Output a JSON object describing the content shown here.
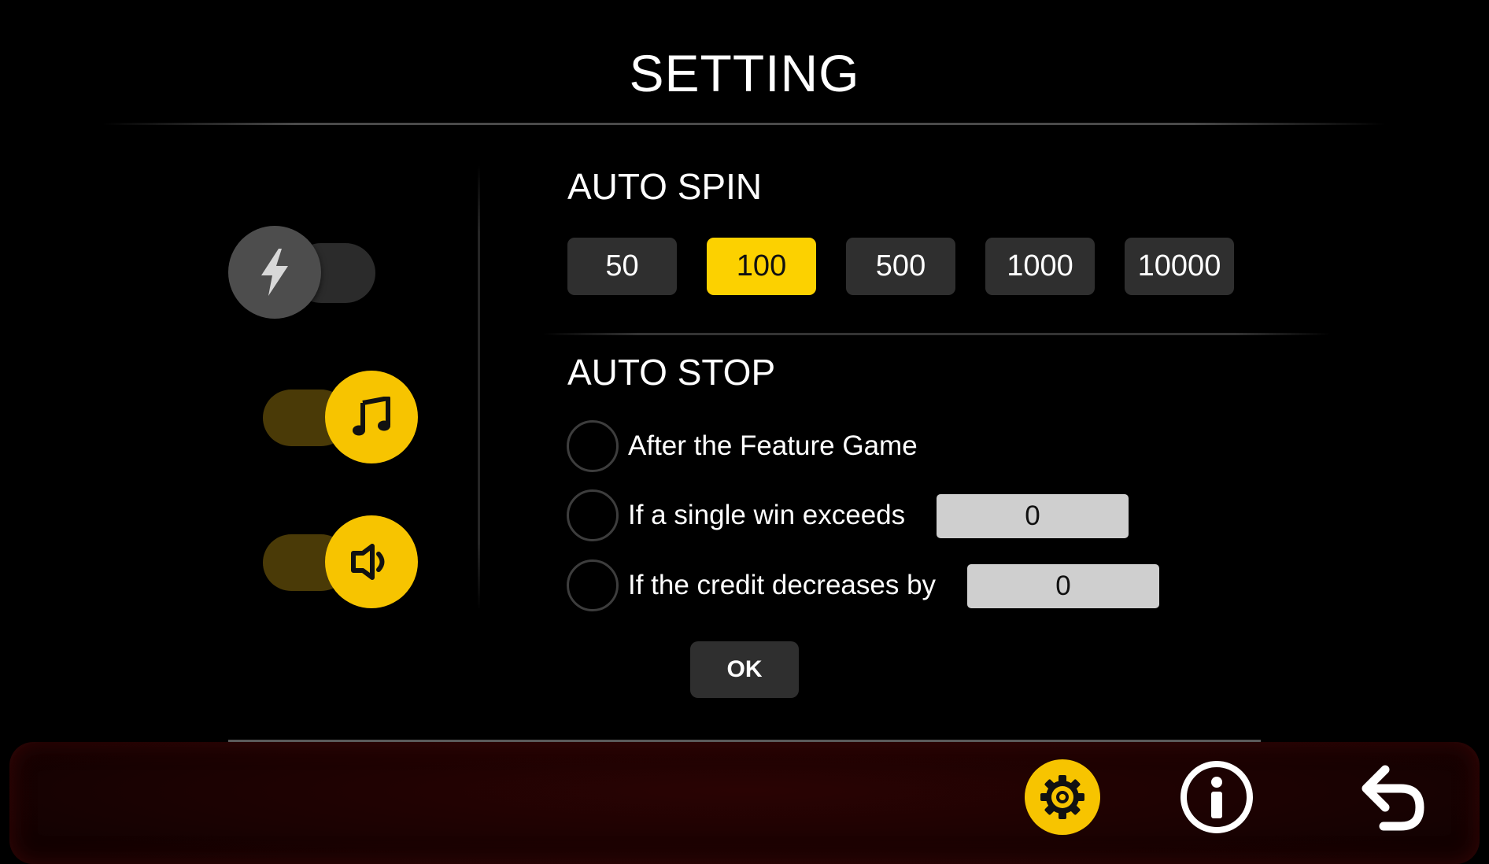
{
  "header": {
    "title": "SETTING"
  },
  "left_toggles": [
    {
      "name": "turbo",
      "icon": "lightning-icon",
      "state": "off"
    },
    {
      "name": "music",
      "icon": "music-note-icon",
      "state": "on"
    },
    {
      "name": "sound",
      "icon": "speaker-icon",
      "state": "on"
    }
  ],
  "auto_spin": {
    "label": "AUTO SPIN",
    "options": [
      "50",
      "100",
      "500",
      "1000",
      "10000"
    ],
    "selected": "100"
  },
  "auto_stop": {
    "label": "AUTO STOP",
    "options": [
      {
        "label": "After the Feature Game"
      },
      {
        "label": "If a single win exceeds",
        "value": "0"
      },
      {
        "label": "If the credit decreases by",
        "value": "0"
      }
    ]
  },
  "ok_label": "OK",
  "bottom_bar": {
    "icons": [
      "settings-icon",
      "info-icon",
      "back-icon"
    ]
  },
  "colors": {
    "accent": "#fcd100",
    "button_bg": "#2f2f2f",
    "input_bg": "#cfcfcf",
    "bar_bg": "#1b0202"
  }
}
